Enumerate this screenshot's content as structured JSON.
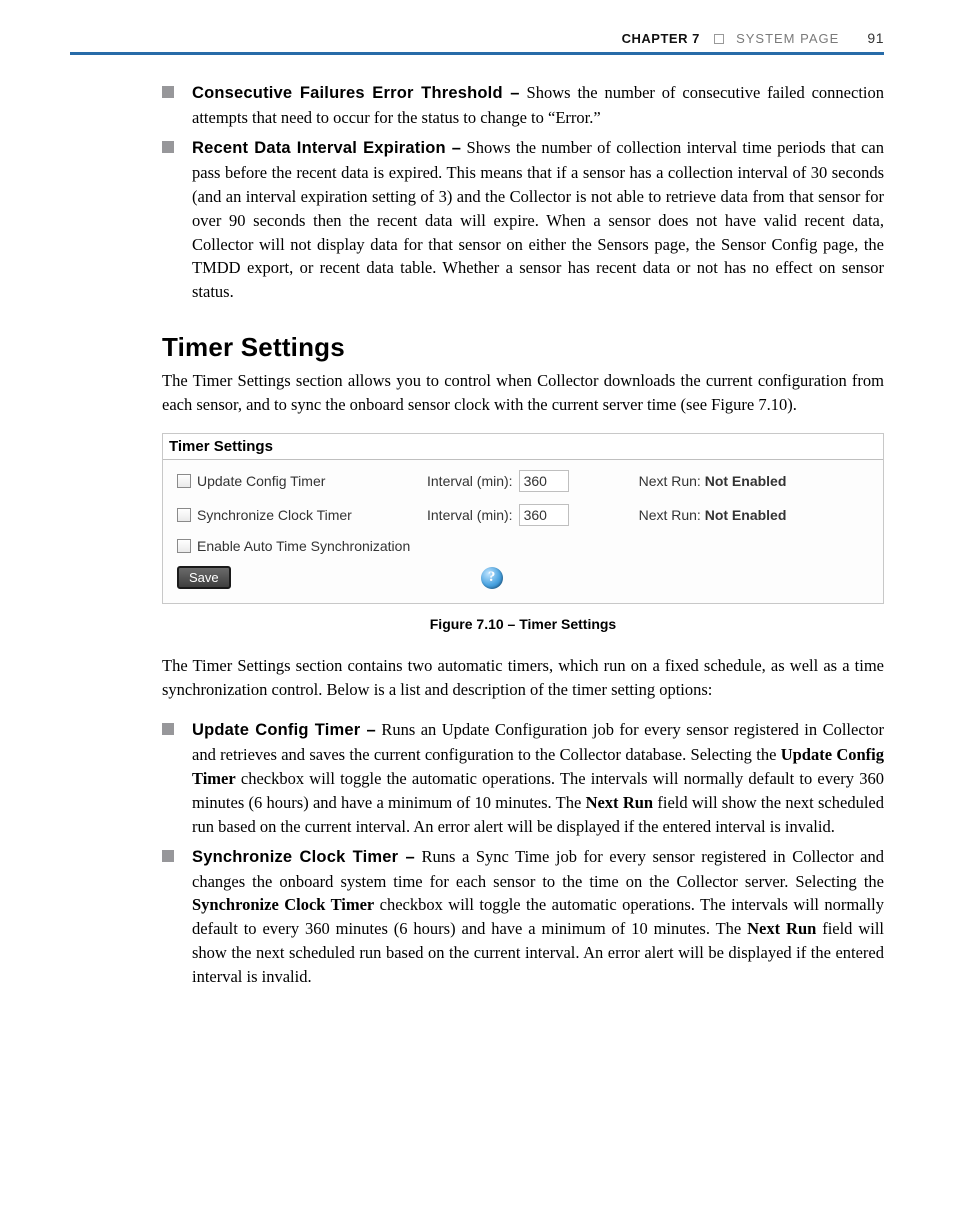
{
  "header": {
    "chapter_label": "CHAPTER 7",
    "chapter_title": "SYSTEM PAGE",
    "page_number": "91"
  },
  "top_bullets": [
    {
      "term": "Consecutive Failures Error Threshold –",
      "text": " Shows the number of consecutive failed connection attempts that need to occur for the status to change to “Error.”"
    },
    {
      "term": "Recent Data Interval Expiration –",
      "text": " Shows the number of collection interval time periods that can pass before the recent data is expired. This means that if a sensor has a collection interval of 30 seconds (and an interval expiration setting of 3) and the Collector is not able to retrieve data from that sensor for over 90 seconds then the recent data will expire. When a sensor does not have valid recent data, Collector will not display data for that sensor on either the Sensors page, the Sensor Config page, the TMDD export, or recent data table. Whether a sensor has recent data or not has no effect on sensor status."
    }
  ],
  "section_heading": "Timer Settings",
  "section_intro": "The Timer Settings section allows you to control when Collector downloads the current configuration from each sensor, and to sync the onboard sensor clock with the current server time (see Figure 7.10).",
  "figure": {
    "panel_title": "Timer Settings",
    "rows": [
      {
        "checkbox_label": "Update Config Timer",
        "interval_label": "Interval (min):",
        "interval_value": "360",
        "nextrun_label": "Next Run:",
        "nextrun_value": "Not Enabled"
      },
      {
        "checkbox_label": "Synchronize Clock Timer",
        "interval_label": "Interval (min):",
        "interval_value": "360",
        "nextrun_label": "Next Run:",
        "nextrun_value": "Not Enabled"
      }
    ],
    "third_checkbox_label": "Enable Auto Time Synchronization",
    "save_label": "Save",
    "help_glyph": "?",
    "caption": "Figure 7.10 – Timer Settings"
  },
  "post_figure_intro": "The Timer Settings section contains two automatic timers, which run on a fixed schedule, as well as a time synchronization control.  Below is a list and description of the timer setting options:",
  "bottom_bullets": [
    {
      "term": "Update Config Timer –",
      "text_before_bold1": " Runs an Update Configuration job for every sensor registered in Collector and retrieves and saves the current configuration to the Collector database. Selecting the ",
      "bold1": "Update Config Timer",
      "text_mid": " checkbox will toggle the automatic operations. The intervals will normally default to every 360 minutes (6 hours) and have a minimum of 10 minutes. The ",
      "bold2": "Next Run",
      "text_after": " field will show the next scheduled run based on the current interval. An error alert will be displayed if the entered interval is invalid."
    },
    {
      "term": "Synchronize Clock Timer –",
      "text_before_bold1": " Runs a Sync Time job for every sensor registered in Collector and changes the onboard system time for each sensor to the time on the Collector server. Selecting the ",
      "bold1": "Synchronize Clock Timer",
      "text_mid": " checkbox will toggle the automatic operations. The intervals will normally default to every 360 minutes (6 hours) and have a minimum of 10 minutes. The ",
      "bold2": "Next Run",
      "text_after": " field will show the next scheduled run based on the current interval. An error alert will be displayed if the entered interval is invalid."
    }
  ]
}
